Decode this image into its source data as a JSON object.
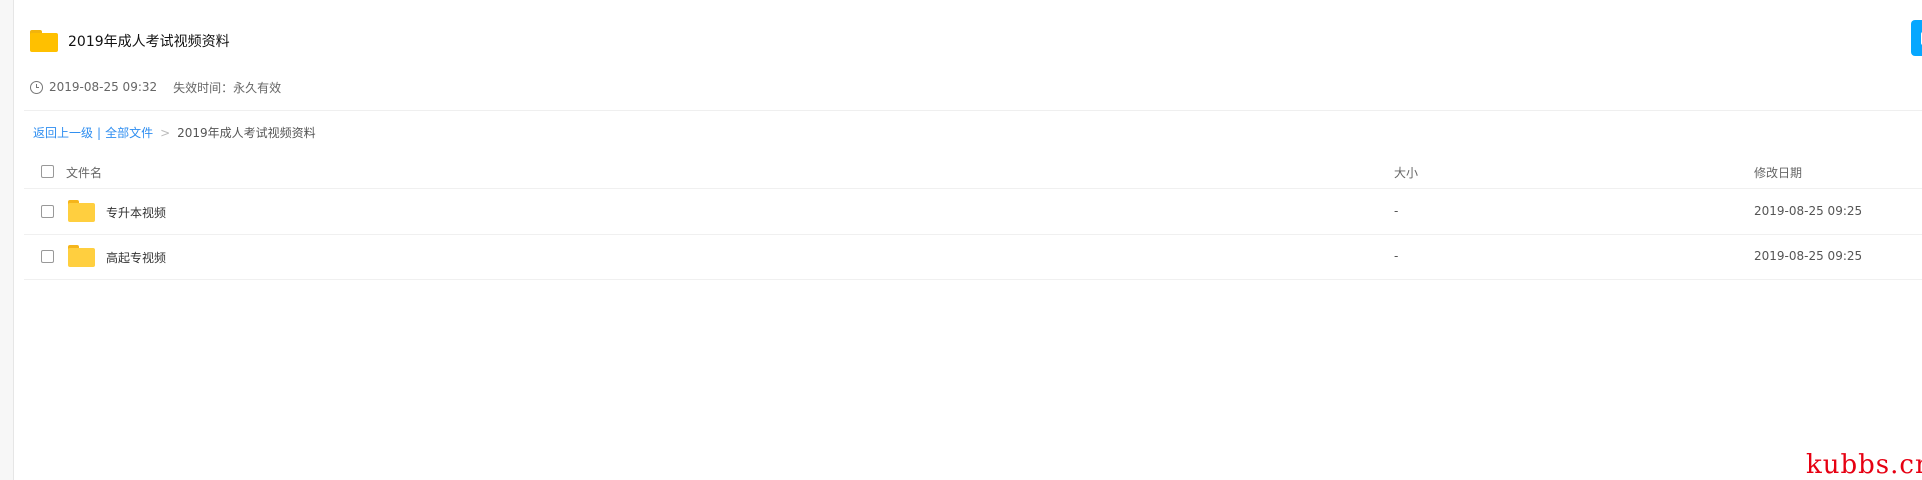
{
  "share": {
    "title": "2019年成人考试视频资料",
    "date": "2019-08-25 09:32",
    "expire_label": "失效时间：",
    "expire_value": "永久有效"
  },
  "breadcrumb": {
    "back": "返回上一级",
    "separator": "|",
    "all_files": "全部文件",
    "arrow": ">",
    "current": "2019年成人考试视频资料"
  },
  "columns": {
    "name": "文件名",
    "size": "大小",
    "date": "修改日期"
  },
  "files": [
    {
      "name": "专升本视频",
      "size": "-",
      "modified": "2019-08-25 09:25",
      "type": "folder"
    },
    {
      "name": "高起专视频",
      "size": "-",
      "modified": "2019-08-25 09:25",
      "type": "folder"
    }
  ],
  "watermark": "kubbs.cn",
  "colors": {
    "accent": "#06a7ff",
    "link": "#2f8ef0",
    "folder": "#ffcf3f",
    "watermark": "#e60012"
  },
  "icons": {
    "header": "folder-icon",
    "meta": "clock-icon",
    "save": "save-to-drive-icon"
  }
}
